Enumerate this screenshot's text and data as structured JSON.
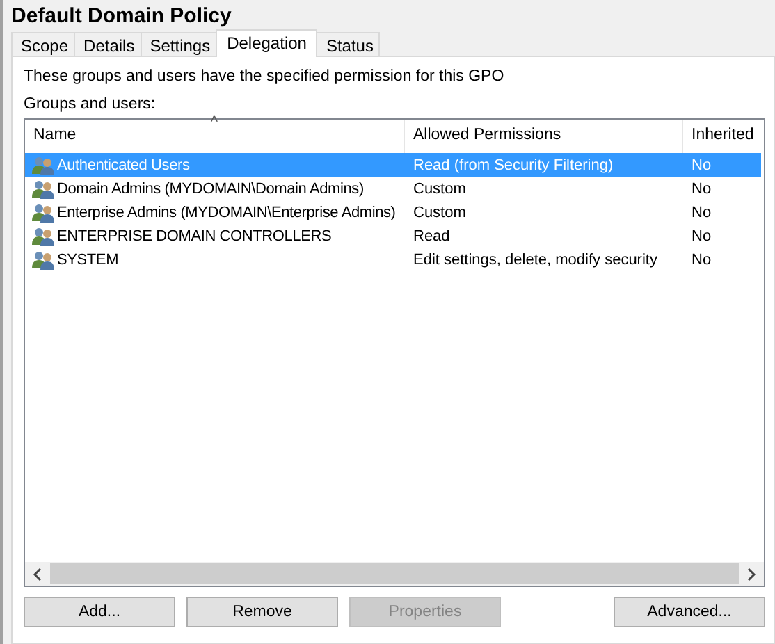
{
  "window": {
    "title": "Default Domain Policy"
  },
  "tabs": [
    {
      "label": "Scope",
      "selected": false
    },
    {
      "label": "Details",
      "selected": false
    },
    {
      "label": "Settings",
      "selected": false
    },
    {
      "label": "Delegation",
      "selected": true
    },
    {
      "label": "Status",
      "selected": false
    }
  ],
  "description": "These groups and users have the specified permission for this GPO",
  "list_label": "Groups and users:",
  "table": {
    "columns": [
      {
        "label": "Name",
        "sorted": true
      },
      {
        "label": "Allowed Permissions",
        "sorted": false
      },
      {
        "label": "Inherited",
        "sorted": false
      }
    ],
    "sort_glyph": "^",
    "rows": [
      {
        "cells": [
          "Authenticated Users",
          "Read (from Security Filtering)",
          "No"
        ],
        "selected": true
      },
      {
        "cells": [
          "Domain Admins (MYDOMAIN\\Domain Admins)",
          "Custom",
          "No"
        ],
        "selected": false
      },
      {
        "cells": [
          "Enterprise Admins (MYDOMAIN\\Enterprise Admins)",
          "Custom",
          "No"
        ],
        "selected": false
      },
      {
        "cells": [
          "ENTERPRISE DOMAIN CONTROLLERS",
          "Read",
          "No"
        ],
        "selected": false
      },
      {
        "cells": [
          "SYSTEM",
          "Edit settings, delete, modify security",
          "No"
        ],
        "selected": false
      }
    ]
  },
  "buttons": [
    {
      "label": "Add...",
      "disabled": false
    },
    {
      "label": "Remove",
      "disabled": false
    },
    {
      "label": "Properties",
      "disabled": true
    },
    {
      "label": "Advanced...",
      "disabled": false
    }
  ]
}
